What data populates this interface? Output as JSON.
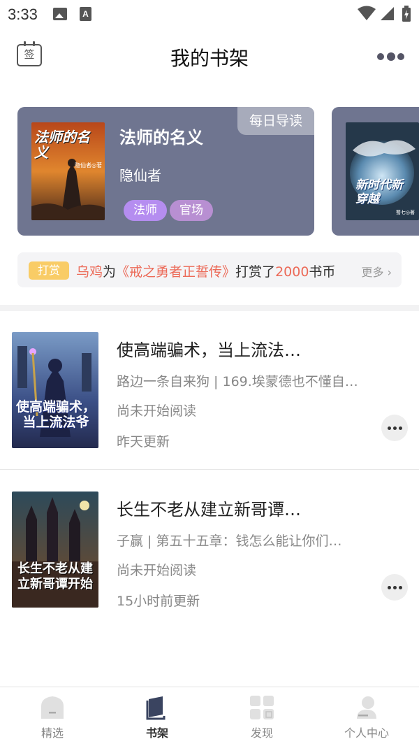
{
  "status_bar": {
    "time": "3:33",
    "notif_letter": "A"
  },
  "header": {
    "calendar_label": "签",
    "title": "我的书架"
  },
  "daily_card": {
    "badge": "每日导读",
    "title": "法师的名义",
    "author": "隐仙者",
    "tags": [
      "法师",
      "官场"
    ],
    "cover_text": "法师的名义",
    "cover_author": "隐仙者◎著",
    "next_cover_text": "新时代新穿越",
    "next_cover_author": "蜀七◎著"
  },
  "tip_bar": {
    "badge": "打赏",
    "user": "乌鸡",
    "word_for": "为",
    "book": "《戒之勇者正誓传》",
    "word_reward": "打赏了",
    "amount": "2000",
    "unit": "书币",
    "more": "更多"
  },
  "books": [
    {
      "title": "使高端骗术，当上流法…",
      "subtitle": "路边一条自来狗 | 169.埃蒙德也不懂自…",
      "status": "尚未开始阅读",
      "update": "昨天更新",
      "cover_text": "使高端骗术，当上流法爷"
    },
    {
      "title": "长生不老从建立新哥谭…",
      "subtitle": "子赢 | 第五十五章：钱怎么能让你们…",
      "status": "尚未开始阅读",
      "update": "15小时前更新",
      "cover_text": "长生不老从建立新哥谭开始"
    }
  ],
  "nav": [
    {
      "label": "精选",
      "active": false
    },
    {
      "label": "书架",
      "active": true
    },
    {
      "label": "发现",
      "active": false
    },
    {
      "label": "个人中心",
      "active": false
    }
  ],
  "colors": {
    "card_bg": "#6f7590",
    "tag_1": "#b58df0",
    "tag_2": "#b88fd2",
    "highlight": "#ec6a58",
    "tip_badge": "#f9cc66"
  }
}
